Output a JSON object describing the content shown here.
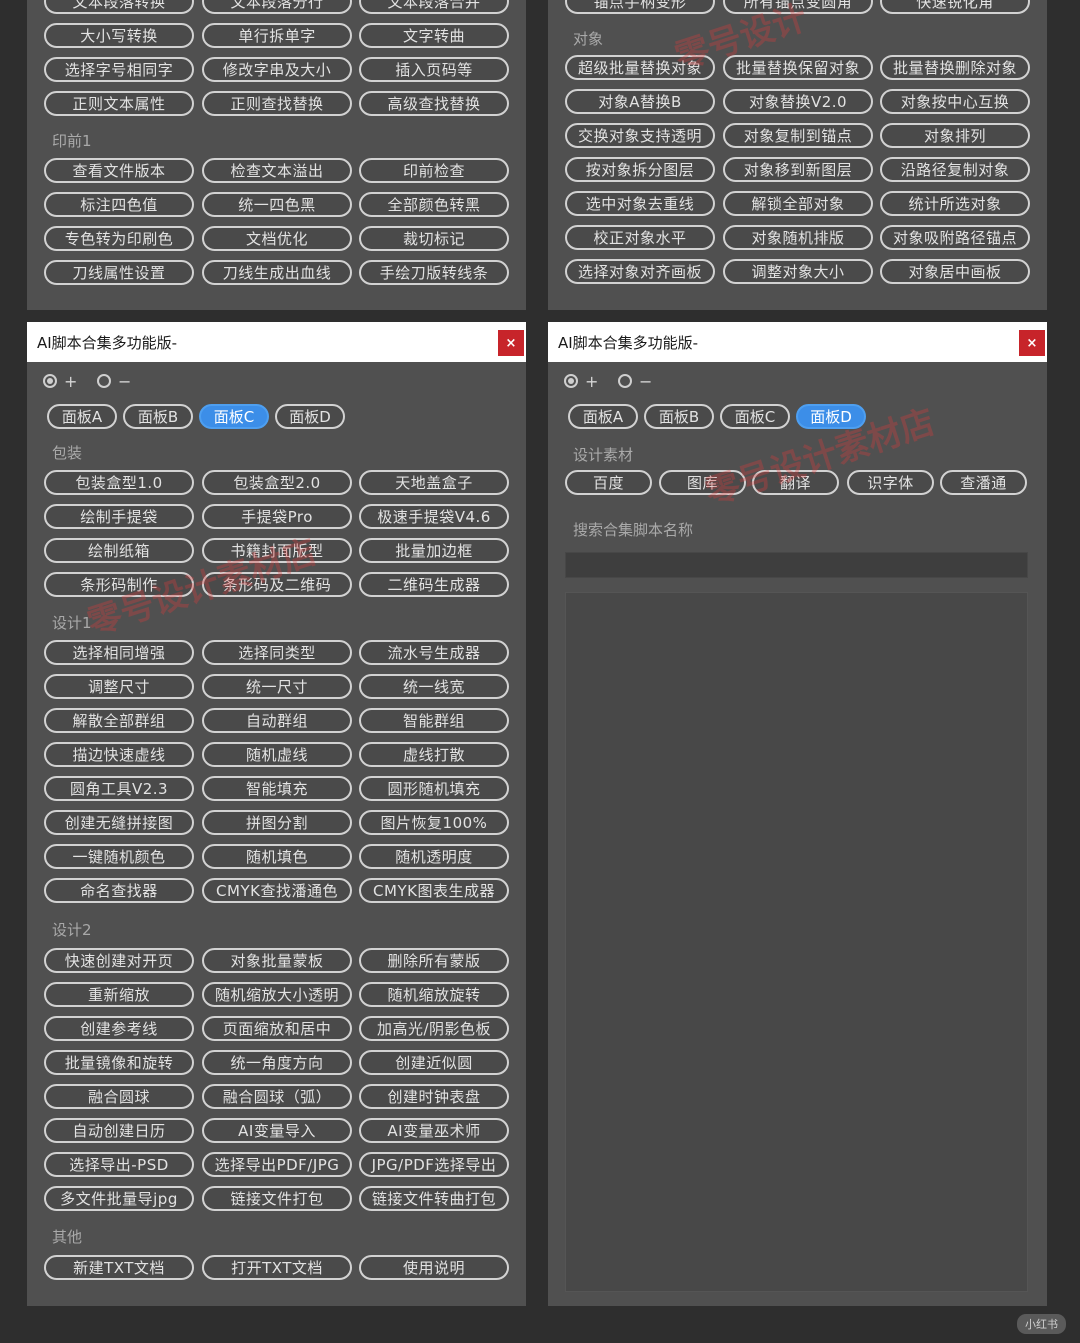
{
  "top_left": {
    "rows": [
      [
        "文本段落转换",
        "文本段落分行",
        "文本段落合并"
      ],
      [
        "大小写转换",
        "单行拆单字",
        "文字转曲"
      ],
      [
        "选择字号相同字",
        "修改字串及大小",
        "插入页码等"
      ],
      [
        "正则文本属性",
        "正则查找替换",
        "高级查找替换"
      ]
    ],
    "section": "印前1",
    "section_rows": [
      [
        "查看文件版本",
        "检查文本溢出",
        "印前检查"
      ],
      [
        "标注四色值",
        "统一四色黑",
        "全部颜色转黑"
      ],
      [
        "专色转为印刷色",
        "文档优化",
        "裁切标记"
      ],
      [
        "刀线属性设置",
        "刀线生成出血线",
        "手绘刀版转线条"
      ]
    ]
  },
  "top_right": {
    "top_row": [
      "锚点手柄变形",
      "所有锚点变圆角",
      "快速锐化角"
    ],
    "section": "对象",
    "rows": [
      [
        "超级批量替换对象",
        "批量替换保留对象",
        "批量替换删除对象"
      ],
      [
        "对象A替换B",
        "对象替换V2.0",
        "对象按中心互换"
      ],
      [
        "交换对象支持透明",
        "对象复制到锚点",
        "对象排列"
      ],
      [
        "按对象拆分图层",
        "对象移到新图层",
        "沿路径复制对象"
      ],
      [
        "选中对象去重线",
        "解锁全部对象",
        "统计所选对象"
      ],
      [
        "校正对象水平",
        "对象随机排版",
        "对象吸附路径锚点"
      ],
      [
        "选择对象对齐画板",
        "调整对象大小",
        "对象居中画板"
      ]
    ]
  },
  "left_panel": {
    "title": "AI脚本合集多功能版-",
    "close": "×",
    "radio_plus": "+",
    "radio_minus": "−",
    "tabs": [
      "面板A",
      "面板B",
      "面板C",
      "面板D"
    ],
    "active_tab": 2,
    "sections": [
      {
        "title": "包装",
        "rows": [
          [
            "包装盒型1.0",
            "包装盒型2.0",
            "天地盖盒子"
          ],
          [
            "绘制手提袋",
            "手提袋Pro",
            "极速手提袋V4.6"
          ],
          [
            "绘制纸箱",
            "书籍封面版型",
            "批量加边框"
          ],
          [
            "条形码制作",
            "条形码及二维码",
            "二维码生成器"
          ]
        ]
      },
      {
        "title": "设计1",
        "rows": [
          [
            "选择相同增强",
            "选择同类型",
            "流水号生成器"
          ],
          [
            "调整尺寸",
            "统一尺寸",
            "统一线宽"
          ],
          [
            "解散全部群组",
            "自动群组",
            "智能群组"
          ],
          [
            "描边快速虚线",
            "随机虚线",
            "虚线打散"
          ],
          [
            "圆角工具V2.3",
            "智能填充",
            "圆形随机填充"
          ],
          [
            "创建无缝拼接图",
            "拼图分割",
            "图片恢复100%"
          ],
          [
            "一键随机颜色",
            "随机填色",
            "随机透明度"
          ],
          [
            "命名查找器",
            "CMYK查找潘通色",
            "CMYK图表生成器"
          ]
        ]
      },
      {
        "title": "设计2",
        "rows": [
          [
            "快速创建对开页",
            "对象批量蒙板",
            "删除所有蒙版"
          ],
          [
            "重新缩放",
            "随机缩放大小透明",
            "随机缩放旋转"
          ],
          [
            "创建参考线",
            "页面缩放和居中",
            "加高光/阴影色板"
          ],
          [
            "批量镜像和旋转",
            "统一角度方向",
            "创建近似圆"
          ],
          [
            "融合圆球",
            "融合圆球（弧）",
            "创建时钟表盘"
          ],
          [
            "自动创建日历",
            "AI变量导入",
            "AI变量巫术师"
          ],
          [
            "选择导出-PSD",
            "选择导出PDF/JPG",
            "JPG/PDF选择导出"
          ],
          [
            "多文件批量导jpg",
            "链接文件打包",
            "链接文件转曲打包"
          ]
        ]
      },
      {
        "title": "其他",
        "rows": [
          [
            "新建TXT文档",
            "打开TXT文档",
            "使用说明"
          ]
        ]
      }
    ]
  },
  "right_panel": {
    "title": "AI脚本合集多功能版-",
    "close": "×",
    "radio_plus": "+",
    "radio_minus": "−",
    "tabs": [
      "面板A",
      "面板B",
      "面板C",
      "面板D"
    ],
    "active_tab": 3,
    "section": "设计素材",
    "buttons": [
      "百度",
      "图库",
      "翻译",
      "识字体",
      "查潘通"
    ],
    "search_label": "搜索合集脚本名称",
    "search_value": ""
  },
  "watermarks": {
    "top_right": "零号设计",
    "left": "零号设计素材店",
    "right": "零号设计素材店"
  },
  "corner_logo": "小红书",
  "colors": {
    "background": "#2e2e2e",
    "panel": "#505050",
    "button_fill": "#4a4a4a",
    "button_border": "#d2d2d2",
    "active_tab": "#3c8ee8",
    "close_button": "#c7242a"
  }
}
